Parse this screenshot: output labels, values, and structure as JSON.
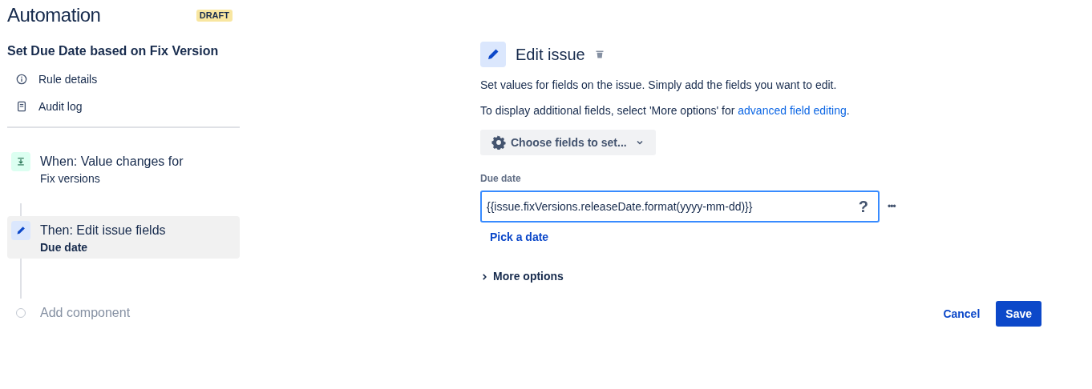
{
  "header": {
    "title": "Automation",
    "badge": "DRAFT"
  },
  "rule": {
    "name": "Set Due Date based on Fix Version",
    "links": [
      {
        "kind": "info",
        "label": "Rule details"
      },
      {
        "kind": "log",
        "label": "Audit log"
      }
    ],
    "components": [
      {
        "kind": "trigger",
        "title": "When: Value changes for",
        "subtitle": "Fix versions",
        "selected": false
      },
      {
        "kind": "action",
        "title": "Then: Edit issue fields",
        "subtitle": "Due date",
        "selected": true
      },
      {
        "kind": "add",
        "title": "Add component"
      }
    ]
  },
  "editor": {
    "title": "Edit issue",
    "description": "Set values for fields on the issue. Simply add the fields you want to edit.",
    "hint": {
      "before": "To display additional fields, select 'More options' for ",
      "link": "advanced field editing",
      "after": "."
    },
    "choose_button": "Choose fields to set...",
    "field": {
      "label": "Due date",
      "value": "{{issue.fixVersions.releaseDate.format(yyyy-mm-dd)}}",
      "help": "?",
      "more": "•••",
      "pick_link": "Pick a date"
    },
    "more_options": {
      "label": "More options",
      "expanded": false
    },
    "buttons": {
      "cancel": "Cancel",
      "save": "Save"
    }
  }
}
